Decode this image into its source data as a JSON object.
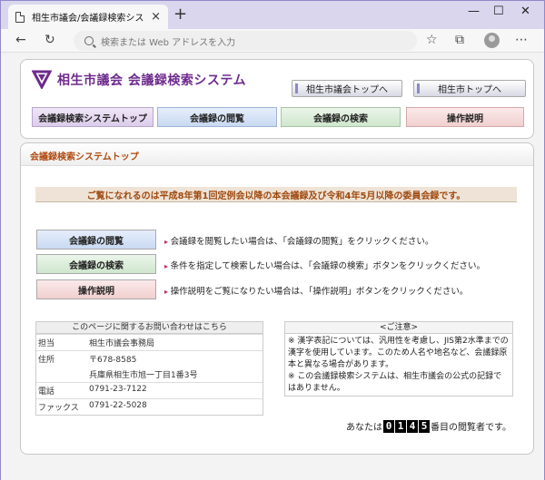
{
  "browser": {
    "tab_title": "相生市議会/会議録検索システム",
    "tab_close": "×",
    "new_tab": "+",
    "min": "—",
    "max": "☐",
    "close": "✕",
    "address_placeholder": "検索または Web アドレスを入力"
  },
  "header": {
    "site_title": "相生市議会 会議録検索システム",
    "link_council_top": "相生市議会トップへ",
    "link_city_top": "相生市トップへ",
    "nav": {
      "top": "会議録検索システムトップ",
      "view": "会議録の閲覧",
      "search": "会議録の検索",
      "help": "操作説明"
    }
  },
  "main": {
    "section_title": "会議録検索システムトップ",
    "banner": "ご覧になれるのは平成8年第1回定例会以降の本会議録及び令和4年5月以降の委員会録です。",
    "actions": [
      {
        "label": "会議録の閲覧",
        "desc": "会議録を閲覧したい場合は、「会議録の閲覧」をクリックください。"
      },
      {
        "label": "会議録の検索",
        "desc": "条件を指定して検索したい場合は、「会議録の検索」ボタンをクリックください。"
      },
      {
        "label": "操作説明",
        "desc": "操作説明をご覧になりたい場合は、「操作説明」ボタンをクリックください。"
      }
    ],
    "contact": {
      "heading": "このページに関するお問い合わせはこちら",
      "rows": [
        {
          "k": "担当",
          "v": "相生市議会事務局"
        },
        {
          "k": "住所",
          "v": "〒678-8585"
        },
        {
          "k": "",
          "v": "兵庫県相生市旭一丁目1番3号"
        },
        {
          "k": "電話",
          "v": "0791-23-7122"
        },
        {
          "k": "ファックス",
          "v": "0791-22-5028"
        }
      ]
    },
    "notice": {
      "heading": "<ご注意>",
      "line1": "※ 漢字表記については、汎用性を考慮し、JIS第2水準までの漢字を使用しています。このため人名や地名など、会議録原本と異なる場合があります。",
      "line2": "※ この会議録検索システムは、相生市議会の公式の記録ではありません。"
    },
    "counter": {
      "prefix": "あなたは",
      "digits": [
        "0",
        "1",
        "4",
        "5"
      ],
      "suffix": "番目の閲覧者です。"
    }
  }
}
